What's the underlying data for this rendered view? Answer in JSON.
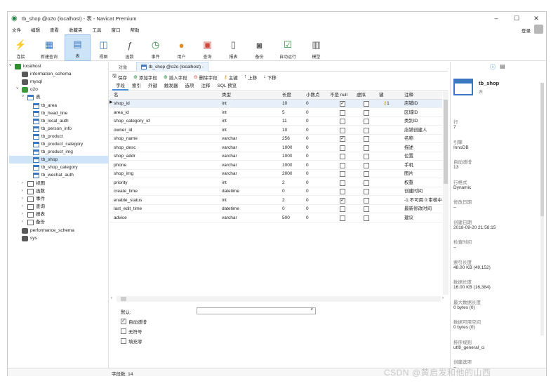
{
  "window": {
    "title": "tb_shop @o2o (localhost) - 表 - Navicat Premium",
    "controls": [
      "–",
      "☐",
      "✕"
    ]
  },
  "menu": {
    "items": [
      "文件",
      "编辑",
      "查看",
      "收藏夹",
      "工具",
      "窗口",
      "帮助"
    ],
    "login": "登录"
  },
  "toolbar": {
    "buttons": [
      {
        "label": "连接",
        "icon": "connection-icon"
      },
      {
        "label": "新建查询",
        "icon": "new-query-icon"
      },
      {
        "label": "表",
        "icon": "table-icon"
      },
      {
        "label": "视图",
        "icon": "view-icon"
      },
      {
        "label": "函数",
        "icon": "function-icon"
      },
      {
        "label": "事件",
        "icon": "event-clock-icon"
      },
      {
        "label": "用户",
        "icon": "user-icon"
      },
      {
        "label": "查询",
        "icon": "query-icon"
      },
      {
        "label": "报表",
        "icon": "report-icon"
      },
      {
        "label": "备份",
        "icon": "backup-icon"
      },
      {
        "label": "自动运行",
        "icon": "automation-icon"
      },
      {
        "label": "模型",
        "icon": "model-icon"
      }
    ]
  },
  "nav": {
    "connection": "localhost",
    "databases": [
      "information_schema",
      "mysql",
      "o2o"
    ],
    "group_tables": "表",
    "tables": [
      "tb_area",
      "tb_head_line",
      "tb_local_auth",
      "tb_person_info",
      "tb_product",
      "tb_product_category",
      "tb_product_img",
      "tb_shop",
      "tb_shop_category",
      "tb_wechat_auth"
    ],
    "groups": [
      "视图",
      "函数",
      "事件",
      "查询",
      "报表",
      "备份"
    ],
    "other_dbs": [
      "performance_schema",
      "sys"
    ]
  },
  "tabs": {
    "object": "对象",
    "doc": "tb_shop @o2o (localhost) -"
  },
  "subtoolbar": [
    "保存",
    "添加字段",
    "插入字段",
    "删除字段",
    "主键",
    "上移",
    "下移"
  ],
  "design_tabs": [
    "字段",
    "索引",
    "外键",
    "触发器",
    "选项",
    "注释",
    "SQL 预览"
  ],
  "grid": {
    "columns": [
      "名",
      "类型",
      "长度",
      "小数点",
      "不是 null",
      "虚拟",
      "键",
      "注释"
    ],
    "rows": [
      {
        "name": "shop_id",
        "type": "int",
        "len": "10",
        "dec": "0",
        "notnull": true,
        "key": "1",
        "comment": "店铺ID"
      },
      {
        "name": "area_id",
        "type": "int",
        "len": "5",
        "dec": "0",
        "notnull": false,
        "key": "",
        "comment": "区域ID"
      },
      {
        "name": "shop_category_id",
        "type": "int",
        "len": "11",
        "dec": "0",
        "notnull": false,
        "key": "",
        "comment": "类别ID"
      },
      {
        "name": "owner_id",
        "type": "int",
        "len": "10",
        "dec": "0",
        "notnull": false,
        "key": "",
        "comment": "店铺创建人"
      },
      {
        "name": "shop_name",
        "type": "varchar",
        "len": "256",
        "dec": "0",
        "notnull": true,
        "key": "",
        "comment": "名称"
      },
      {
        "name": "shop_desc",
        "type": "varchar",
        "len": "1000",
        "dec": "0",
        "notnull": false,
        "key": "",
        "comment": "描述"
      },
      {
        "name": "shop_addr",
        "type": "varchar",
        "len": "1000",
        "dec": "0",
        "notnull": false,
        "key": "",
        "comment": "位置"
      },
      {
        "name": "phone",
        "type": "varchar",
        "len": "1000",
        "dec": "0",
        "notnull": false,
        "key": "",
        "comment": "手机"
      },
      {
        "name": "shop_img",
        "type": "varchar",
        "len": "2000",
        "dec": "0",
        "notnull": false,
        "key": "",
        "comment": "图片"
      },
      {
        "name": "priority",
        "type": "int",
        "len": "2",
        "dec": "0",
        "notnull": false,
        "key": "",
        "comment": "权重"
      },
      {
        "name": "create_time",
        "type": "datetime",
        "len": "0",
        "dec": "0",
        "notnull": false,
        "key": "",
        "comment": "创建时间"
      },
      {
        "name": "enable_status",
        "type": "int",
        "len": "2",
        "dec": "0",
        "notnull": true,
        "key": "",
        "comment": "-1:不可用 0:审核中"
      },
      {
        "name": "last_edit_time",
        "type": "datetime",
        "len": "0",
        "dec": "0",
        "notnull": false,
        "key": "",
        "comment": "最新修改时间"
      },
      {
        "name": "advice",
        "type": "varchar",
        "len": "500",
        "dec": "0",
        "notnull": false,
        "key": "",
        "comment": "建议"
      }
    ]
  },
  "props": {
    "default_label": "默认:",
    "auto_increment": "自动递增",
    "unsigned": "无符号",
    "zerofill": "填充零",
    "auto_increment_checked": true
  },
  "status": {
    "fields": "字段数: 14"
  },
  "info": {
    "table_name": "tb_shop",
    "table_kind": "表",
    "items": [
      {
        "label": "行",
        "value": "7"
      },
      {
        "label": "引擎",
        "value": "InnoDB"
      },
      {
        "label": "自动递增",
        "value": "13"
      },
      {
        "label": "行格式",
        "value": "Dynamic"
      },
      {
        "label": "修改日期",
        "value": "--"
      },
      {
        "label": "创建日期",
        "value": "2018-09-20 21:58:15"
      },
      {
        "label": "检查时间",
        "value": "--"
      },
      {
        "label": "索引长度",
        "value": "48.00 KB (49,152)"
      },
      {
        "label": "数据长度",
        "value": "16.00 KB (16,384)"
      },
      {
        "label": "最大数据长度",
        "value": "0 bytes (0)"
      },
      {
        "label": "数据可用空间",
        "value": "0 bytes (0)"
      },
      {
        "label": "排序规则",
        "value": "utf8_general_ci"
      },
      {
        "label": "创建选项",
        "value": "--"
      }
    ]
  },
  "watermark": "CSDN @黄启发和他的山西"
}
